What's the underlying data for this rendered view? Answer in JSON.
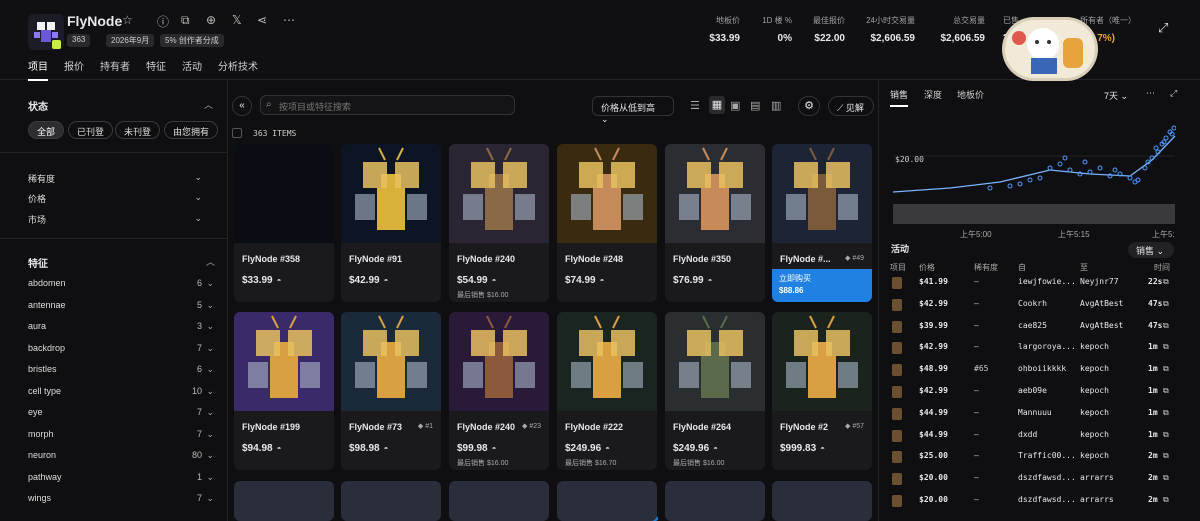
{
  "header": {
    "title": "FlyNode",
    "chips": [
      "363",
      "2026年9月",
      "5% 创作者分成"
    ],
    "stats": [
      {
        "label": "地板价",
        "value": "$33.99"
      },
      {
        "label": "1D 楼 %",
        "value": "0%"
      },
      {
        "label": "最佳报价",
        "value": "$22.00"
      },
      {
        "label": "24小时交易量",
        "value": "$2,606.59"
      },
      {
        "label": "总交易量",
        "value": "$2,606.59"
      },
      {
        "label": "已售",
        "value": "20"
      },
      {
        "label": "所有者（唯一）",
        "value": "(34.7%)"
      }
    ]
  },
  "tabs": [
    "项目",
    "报价",
    "持有者",
    "特征",
    "活动",
    "分析技术"
  ],
  "sidebar": {
    "status_title": "状态",
    "filters": [
      "全部",
      "已刊登",
      "未刊登",
      "由您拥有"
    ],
    "groups": [
      "稀有度",
      "价格",
      "市场"
    ],
    "traits_title": "特征",
    "traits": [
      {
        "name": "abdomen",
        "count": "6"
      },
      {
        "name": "antennae",
        "count": "5"
      },
      {
        "name": "aura",
        "count": "3"
      },
      {
        "name": "backdrop",
        "count": "7"
      },
      {
        "name": "bristles",
        "count": "6"
      },
      {
        "name": "cell type",
        "count": "10"
      },
      {
        "name": "eye",
        "count": "7"
      },
      {
        "name": "morph",
        "count": "7"
      },
      {
        "name": "neuron",
        "count": "80"
      },
      {
        "name": "pathway",
        "count": "1"
      },
      {
        "name": "wings",
        "count": "7"
      }
    ]
  },
  "toolbar": {
    "search_placeholder": "按项目或特征搜索",
    "sort": "价格从低到高",
    "insight": "见解",
    "items_count": "363 ITEMS"
  },
  "cards": [
    {
      "name": "FlyNode #358",
      "price": "$33.99",
      "last": "",
      "rank": "",
      "bg": "#0b0d14",
      "body": ""
    },
    {
      "name": "FlyNode #91",
      "price": "$42.99",
      "last": "",
      "rank": "",
      "bg": "#0d1424",
      "body": "#d8b13a"
    },
    {
      "name": "FlyNode #240",
      "price": "$54.99",
      "last": "最后销售 $16.00",
      "rank": "",
      "bg": "#2a2433",
      "body": "#8a6a44"
    },
    {
      "name": "FlyNode #248",
      "price": "$74.99",
      "last": "",
      "rank": "",
      "bg": "#3a2a10",
      "body": "#c48a5a"
    },
    {
      "name": "FlyNode #350",
      "price": "$76.99",
      "last": "",
      "rank": "",
      "bg": "#2c2d33",
      "body": "#c98a5a"
    },
    {
      "name": "FlyNode #...",
      "price": "$88.86",
      "last": "",
      "rank": "#49",
      "bg": "#1c2436",
      "body": "#7a5a3a",
      "buy": "立即购买"
    },
    {
      "name": "FlyNode #199",
      "price": "$94.98",
      "last": "",
      "rank": "",
      "bg": "#3a2a6a",
      "body": "#d8a040"
    },
    {
      "name": "FlyNode #73",
      "price": "$98.98",
      "last": "",
      "rank": "#1",
      "bg": "#1a2a3a",
      "body": "#d8a040"
    },
    {
      "name": "FlyNode #240",
      "price": "$99.98",
      "last": "最后销售 $16.00",
      "rank": "#23",
      "bg": "#2a1a3a",
      "body": "#8a5a3a"
    },
    {
      "name": "FlyNode #222",
      "price": "$249.96",
      "last": "最后销售 $16.70",
      "rank": "",
      "bg": "#1a2420",
      "body": "#d8a040"
    },
    {
      "name": "FlyNode #264",
      "price": "$249.96",
      "last": "最后销售 $16.00",
      "rank": "",
      "bg": "#2a2e30",
      "body": "#5a6a4a"
    },
    {
      "name": "FlyNode #2",
      "price": "$999.83",
      "last": "",
      "rank": "#57",
      "bg": "#1a241c",
      "body": "#d8a040"
    }
  ],
  "right": {
    "tabs": [
      "销售",
      "深度",
      "地板价"
    ],
    "period": "7天",
    "ylabel": "$20.00",
    "xticks": [
      "上午5:00",
      "上午5:15",
      "上午5:"
    ],
    "activity_title": "活动",
    "activity_filter": "销售",
    "cols": [
      "项目",
      "价格",
      "稀有度",
      "自",
      "至",
      "时间"
    ],
    "rows": [
      {
        "price": "$41.99",
        "rarity": "–",
        "from": "iewjfowie...",
        "to": "Neyjnr77",
        "time": "22s"
      },
      {
        "price": "$42.99",
        "rarity": "–",
        "from": "Cookrh",
        "to": "AvgAtBest",
        "time": "47s"
      },
      {
        "price": "$39.99",
        "rarity": "–",
        "from": "cae825",
        "to": "AvgAtBest",
        "time": "47s"
      },
      {
        "price": "$42.99",
        "rarity": "–",
        "from": "largoroya...",
        "to": "kepoch",
        "time": "1m"
      },
      {
        "price": "$48.99",
        "rarity": "#65",
        "from": "ohboiikkkk",
        "to": "kepoch",
        "time": "1m"
      },
      {
        "price": "$42.99",
        "rarity": "–",
        "from": "aeb09e",
        "to": "kepoch",
        "time": "1m"
      },
      {
        "price": "$44.99",
        "rarity": "–",
        "from": "Mannuuu",
        "to": "kepoch",
        "time": "1m"
      },
      {
        "price": "$44.99",
        "rarity": "–",
        "from": "dxdd",
        "to": "kepoch",
        "time": "1m"
      },
      {
        "price": "$25.00",
        "rarity": "–",
        "from": "Traffic00...",
        "to": "kepoch",
        "time": "2m"
      },
      {
        "price": "$20.00",
        "rarity": "–",
        "from": "dszdfawsd...",
        "to": "arrarrs",
        "time": "2m"
      },
      {
        "price": "$20.00",
        "rarity": "–",
        "from": "dszdfawsd...",
        "to": "arrarrs",
        "time": "2m"
      }
    ]
  }
}
